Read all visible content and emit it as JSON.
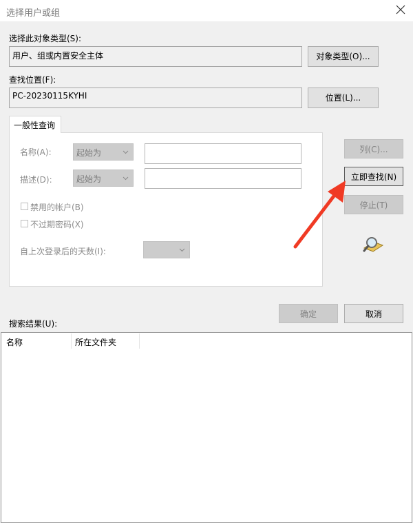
{
  "window": {
    "title": "选择用户或组",
    "close_icon": "close-icon"
  },
  "object_type": {
    "label": "选择此对象类型(S):",
    "value": "用户、组或内置安全主体",
    "button": "对象类型(O)..."
  },
  "location": {
    "label": "查找位置(F):",
    "value": "PC-20230115KYHI",
    "button": "位置(L)..."
  },
  "tab": {
    "label": "一般性查询",
    "name_label": "名称(A):",
    "name_combo": "起始为",
    "desc_label": "描述(D):",
    "desc_combo": "起始为",
    "disabled_accounts": "禁用的帐户(B)",
    "non_expiring_pw": "不过期密码(X)",
    "days_since_logon": "自上次登录后的天数(I):"
  },
  "side_buttons": {
    "columns": "列(C)...",
    "find_now": "立即查找(N)",
    "stop": "停止(T)"
  },
  "footer_buttons": {
    "ok": "确定",
    "cancel": "取消"
  },
  "results": {
    "label": "搜索结果(U):",
    "columns": [
      "名称",
      "所在文件夹"
    ]
  },
  "annotation": {
    "arrow_color": "#f03a24",
    "accent": "#3c3c3c"
  }
}
